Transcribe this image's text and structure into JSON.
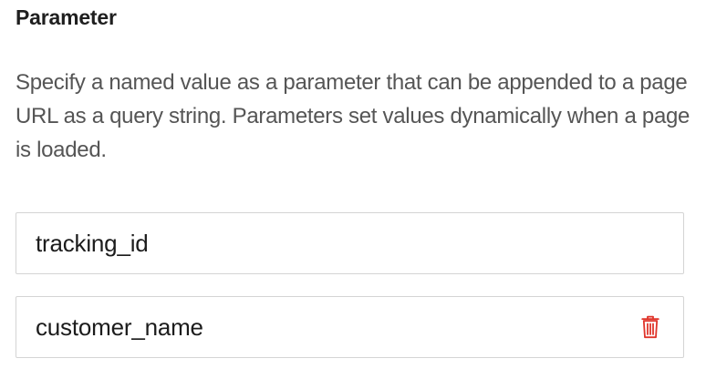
{
  "parameter_section": {
    "title": "Parameter",
    "description": "Specify a named value as a parameter that can be appended to a page URL as a query string. Parameters set values dynamically when a page is loaded.",
    "parameters": [
      {
        "value": "tracking_id",
        "deletable": false
      },
      {
        "value": "customer_name",
        "deletable": true,
        "delete_icon": "trash-icon"
      }
    ]
  },
  "colors": {
    "delete_icon": "#e0352b",
    "field_border": "#d4d4d4",
    "description_text": "#555555"
  }
}
